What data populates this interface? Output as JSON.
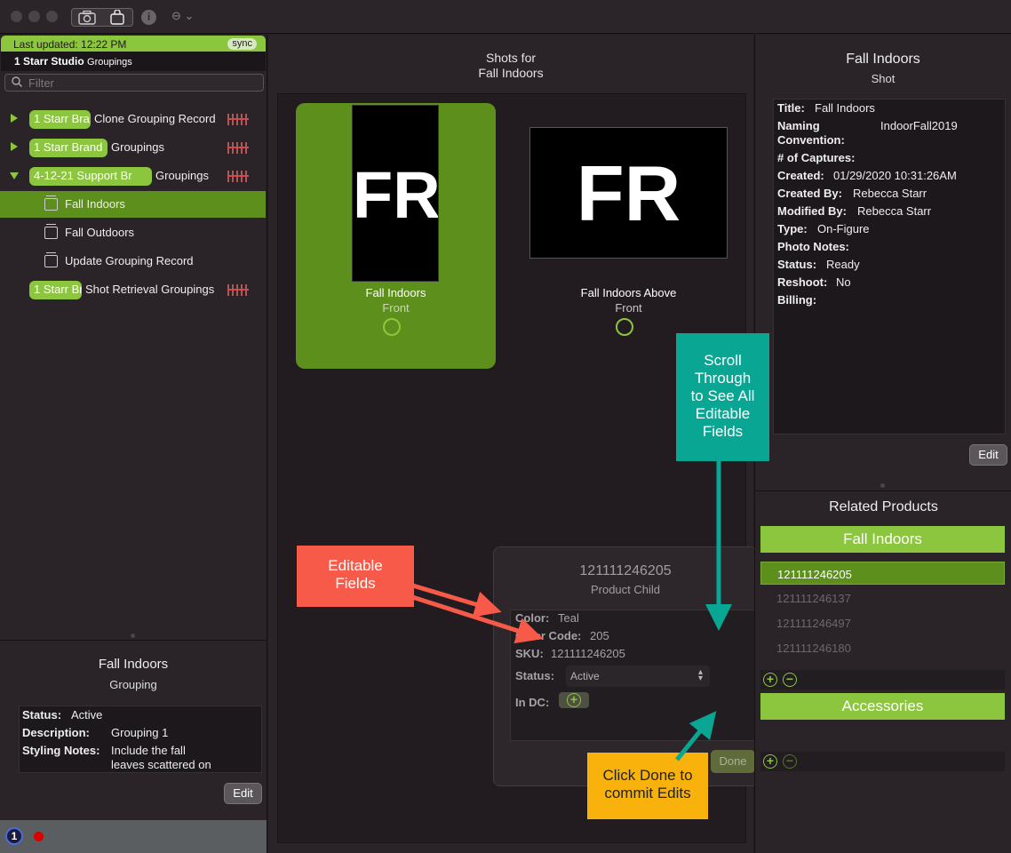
{
  "toolbar": {
    "info_label": "i",
    "more_label": "⊖ ⌄"
  },
  "sidebar": {
    "last_updated": "Last updated: 12:22 PM",
    "sync_label": "sync",
    "studio_name": "1 Starr Studio",
    "studio_suffix": "Groupings",
    "filter_placeholder": "Filter",
    "rows": [
      {
        "badge": "1 Starr Bra",
        "label": "Clone Grouping Record"
      },
      {
        "badge": "1 Starr Brand",
        "label": "Groupings"
      },
      {
        "badge": "4-12-21 Support Br",
        "label": "Groupings"
      },
      {
        "label": "Fall Indoors"
      },
      {
        "label": "Fall Outdoors"
      },
      {
        "label": "Update Grouping Record"
      },
      {
        "badge": "1 Starr Br",
        "label": "Shot Retrieval Groupings"
      }
    ]
  },
  "grouping": {
    "title": "Fall Indoors",
    "subtitle": "Grouping",
    "status_key": "Status:",
    "status_val": "Active",
    "desc_key": "Description:",
    "desc_val": "Grouping 1",
    "notes_key": "Styling Notes:",
    "notes_val_1": "Include the fall",
    "notes_val_2": "leaves scattered on",
    "edit_label": "Edit"
  },
  "footer": {
    "badge": "1"
  },
  "center": {
    "title_line1": "Shots for",
    "title_line2": "Fall Indoors",
    "shots": [
      {
        "thumb_text": "FR",
        "name": "Fall Indoors",
        "view": "Front"
      },
      {
        "thumb_text": "FR",
        "name": "Fall Indoors Above",
        "view": "Front"
      }
    ]
  },
  "popover": {
    "id": "121111246205",
    "type": "Product Child",
    "color_key": "Color:",
    "color_val": "Teal",
    "code_key": "Color Code:",
    "code_val": "205",
    "sku_key": "SKU:",
    "sku_val": "121111246205",
    "status_key": "Status:",
    "status_val": "Active",
    "indc_key": "In DC:",
    "done_label": "Done"
  },
  "shot_detail": {
    "title": "Fall Indoors",
    "subtitle": "Shot",
    "fields": [
      {
        "key": "Title:",
        "val": "Fall Indoors"
      },
      {
        "key": "Naming",
        "val": "IndoorFall2019"
      },
      {
        "key": "Convention:",
        "val": ""
      },
      {
        "key": "# of Captures:",
        "val": ""
      },
      {
        "key": "Created:",
        "val": "01/29/2020 10:31:26AM"
      },
      {
        "key": "Created By:",
        "val": "Rebecca Starr"
      },
      {
        "key": "Modified By:",
        "val": "Rebecca Starr"
      },
      {
        "key": "Type:",
        "val": "On-Figure"
      },
      {
        "key": "Photo Notes:",
        "val": ""
      },
      {
        "key": "Status:",
        "val": "Ready"
      },
      {
        "key": "Reshoot:",
        "val": "No"
      },
      {
        "key": "Billing:",
        "val": ""
      }
    ],
    "edit_label": "Edit"
  },
  "related": {
    "title": "Related Products",
    "group1": "Fall Indoors",
    "products": [
      "121111246205",
      "121111246137",
      "121111246497",
      "121111246180"
    ],
    "group2": "Accessories"
  },
  "callouts": {
    "editable_1": "Editable",
    "editable_2": "Fields",
    "scroll_1": "Scroll",
    "scroll_2": "Through",
    "scroll_3": "to See All",
    "scroll_4": "Editable",
    "scroll_5": "Fields",
    "done_1": "Click Done to",
    "done_2": "commit Edits"
  },
  "colors": {
    "accent_green": "#8cc63e",
    "selected_green": "#5c8f1c",
    "callout_red": "#f75a49",
    "callout_teal": "#08a693",
    "callout_yellow": "#f8b20b"
  }
}
